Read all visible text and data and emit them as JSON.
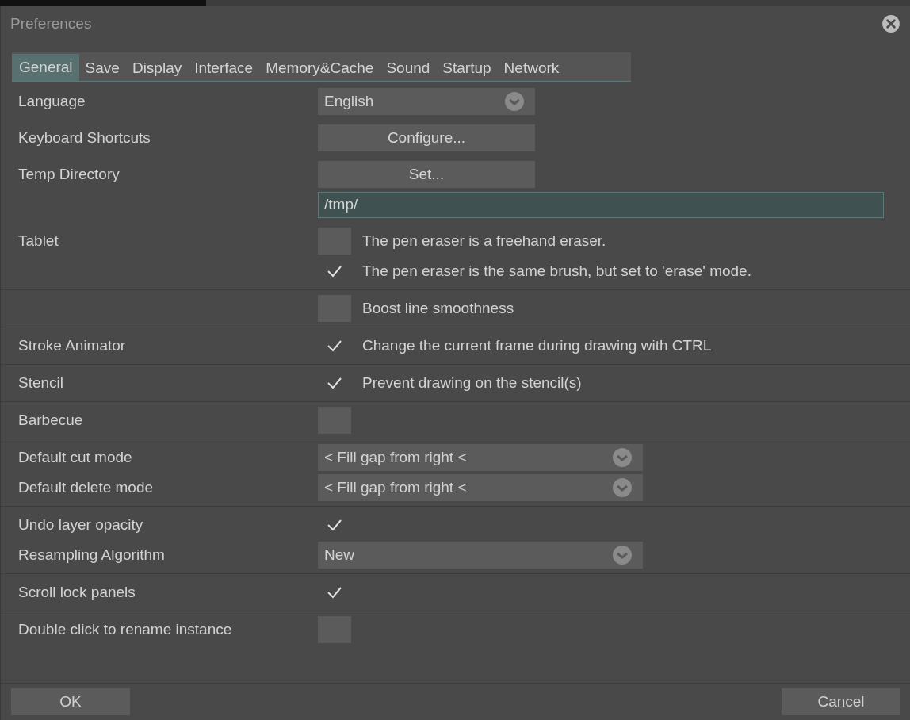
{
  "window": {
    "title": "Preferences"
  },
  "tabs": [
    {
      "label": "General",
      "selected": true
    },
    {
      "label": "Save",
      "selected": false
    },
    {
      "label": "Display",
      "selected": false
    },
    {
      "label": "Interface",
      "selected": false
    },
    {
      "label": "Memory&Cache",
      "selected": false
    },
    {
      "label": "Sound",
      "selected": false
    },
    {
      "label": "Startup",
      "selected": false
    },
    {
      "label": "Network",
      "selected": false
    }
  ],
  "sections": [
    {
      "divider": false,
      "rows": [
        {
          "label": "Language",
          "kind": "dropdown",
          "value": "English",
          "wide": false
        }
      ]
    },
    {
      "divider": false,
      "rows": [
        {
          "label": "Keyboard Shortcuts",
          "kind": "button",
          "text": "Configure..."
        }
      ]
    },
    {
      "divider": false,
      "rows": [
        {
          "label": "Temp Directory",
          "kind": "button",
          "text": "Set..."
        },
        {
          "kind": "field",
          "value": "/tmp/"
        }
      ]
    },
    {
      "divider": true,
      "rows": [
        {
          "label": "Tablet",
          "kind": "checkbox",
          "checked": false,
          "text": "The pen eraser is a freehand eraser."
        },
        {
          "kind": "checkbox",
          "checked": true,
          "text": "The pen eraser is the same brush, but set to 'erase' mode."
        }
      ]
    },
    {
      "divider": true,
      "rows": [
        {
          "kind": "checkbox",
          "checked": false,
          "text": "Boost line smoothness"
        }
      ]
    },
    {
      "divider": true,
      "rows": [
        {
          "label": "Stroke Animator",
          "kind": "checkbox",
          "checked": true,
          "text": "Change the current frame during drawing with CTRL"
        }
      ]
    },
    {
      "divider": true,
      "rows": [
        {
          "label": "Stencil",
          "kind": "checkbox",
          "checked": true,
          "text": "Prevent drawing on the stencil(s)"
        }
      ]
    },
    {
      "divider": true,
      "rows": [
        {
          "label": "Barbecue",
          "kind": "checkbox",
          "checked": false
        }
      ]
    },
    {
      "divider": true,
      "rows": [
        {
          "label": "Default cut mode",
          "kind": "dropdown",
          "value": "< Fill gap from right <",
          "wide": true
        },
        {
          "label": "Default delete mode",
          "kind": "dropdown",
          "value": "< Fill gap from right <",
          "wide": true
        }
      ]
    },
    {
      "divider": true,
      "rows": [
        {
          "label": "Undo layer opacity",
          "kind": "checkbox",
          "checked": true
        },
        {
          "label": "Resampling Algorithm",
          "kind": "dropdown",
          "value": "New",
          "wide": true
        }
      ]
    },
    {
      "divider": true,
      "rows": [
        {
          "label": "Scroll lock panels",
          "kind": "checkbox",
          "checked": true
        }
      ]
    },
    {
      "divider": false,
      "rows": [
        {
          "label": "Double click to rename instance",
          "kind": "checkbox",
          "checked": false
        }
      ]
    }
  ],
  "buttons": [
    {
      "label": "OK"
    },
    {
      "label": "Cancel"
    }
  ]
}
